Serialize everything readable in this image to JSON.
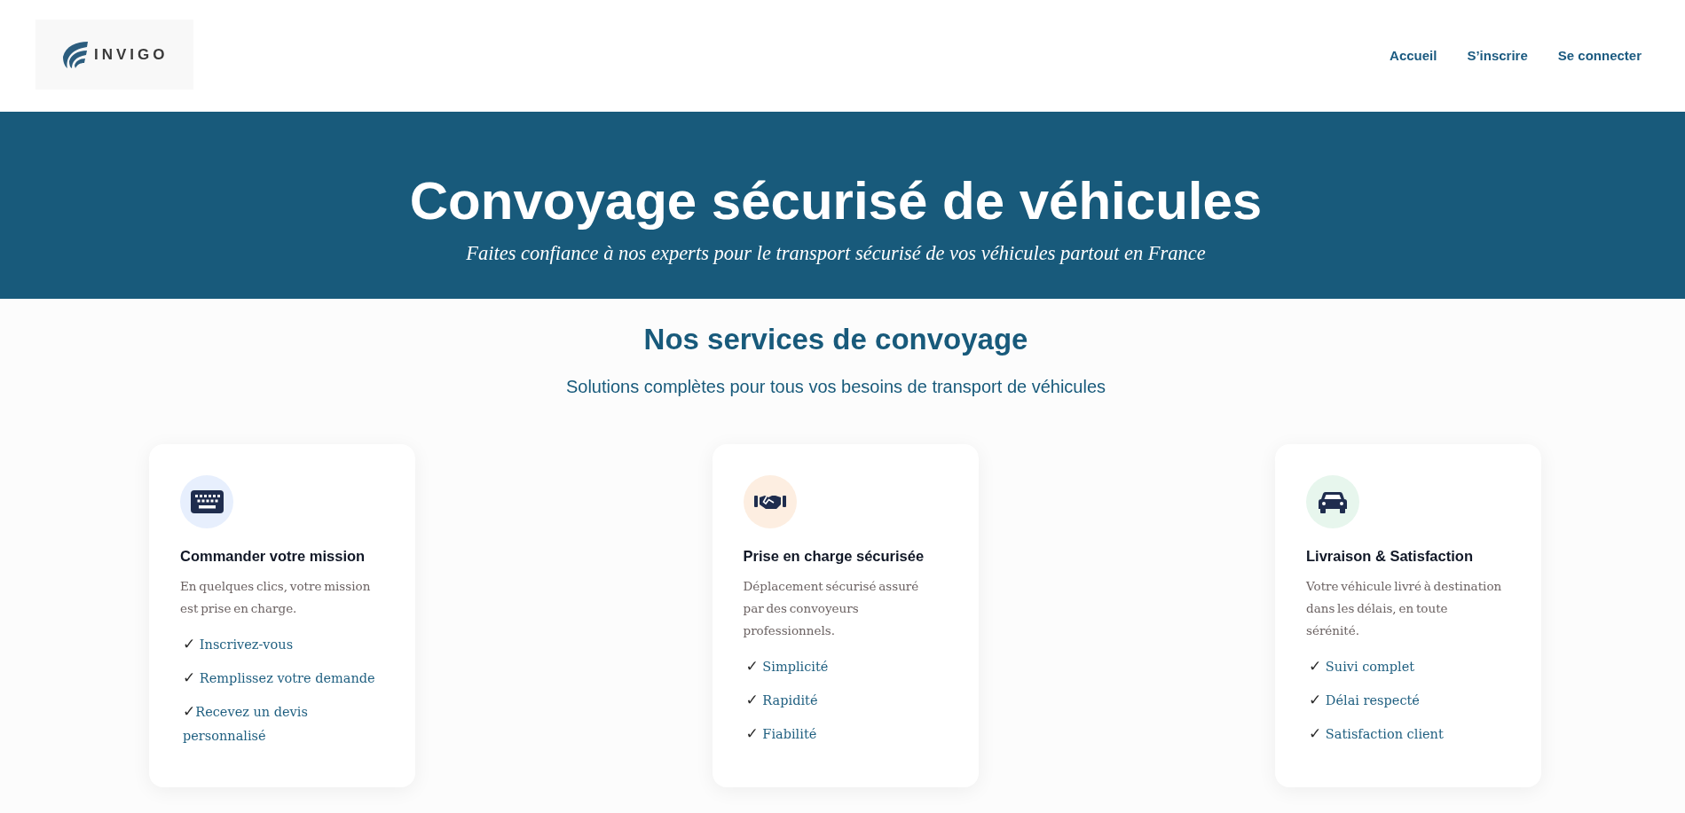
{
  "header": {
    "logo": {
      "brand": "INVIGO"
    },
    "nav": [
      {
        "label": "Accueil"
      },
      {
        "label": "S’inscrire"
      },
      {
        "label": "Se connecter"
      }
    ]
  },
  "hero": {
    "title": "Convoyage sécurisé de véhicules",
    "subtitle": "Faites confiance à nos experts pour le transport sécurisé de vos véhicules partout en France"
  },
  "services": {
    "title": "Nos services de convoyage",
    "subtitle": "Solutions complètes pour tous vos besoins de transport de véhicules",
    "cards": [
      {
        "color": "#e7effd",
        "title": "Commander votre mission",
        "description": "En quelques clics, votre mission est prise en charge.",
        "points": [
          "**✓** Inscrivez-vous",
          "**✓** Remplissez votre demande",
          "**✓**Recevez un devis personnalisé"
        ]
      },
      {
        "color": "#fdeee1",
        "title": "Prise en charge sécurisée",
        "description": "Déplacement sécurisé assuré par des convoyeurs professionnels.",
        "points": [
          "**✓** Simplicité",
          "**✓** Rapidité",
          "**✓** Fiabilité"
        ]
      },
      {
        "color": "#e7f6ed",
        "title": "Livraison & Satisfaction",
        "description": "Votre véhicule livré à destination dans les délais, en toute sérénité.",
        "points": [
          "**✓** Suivi complet",
          "**✓** Délai respecté",
          "**✓** Satisfaction client"
        ]
      }
    ]
  }
}
